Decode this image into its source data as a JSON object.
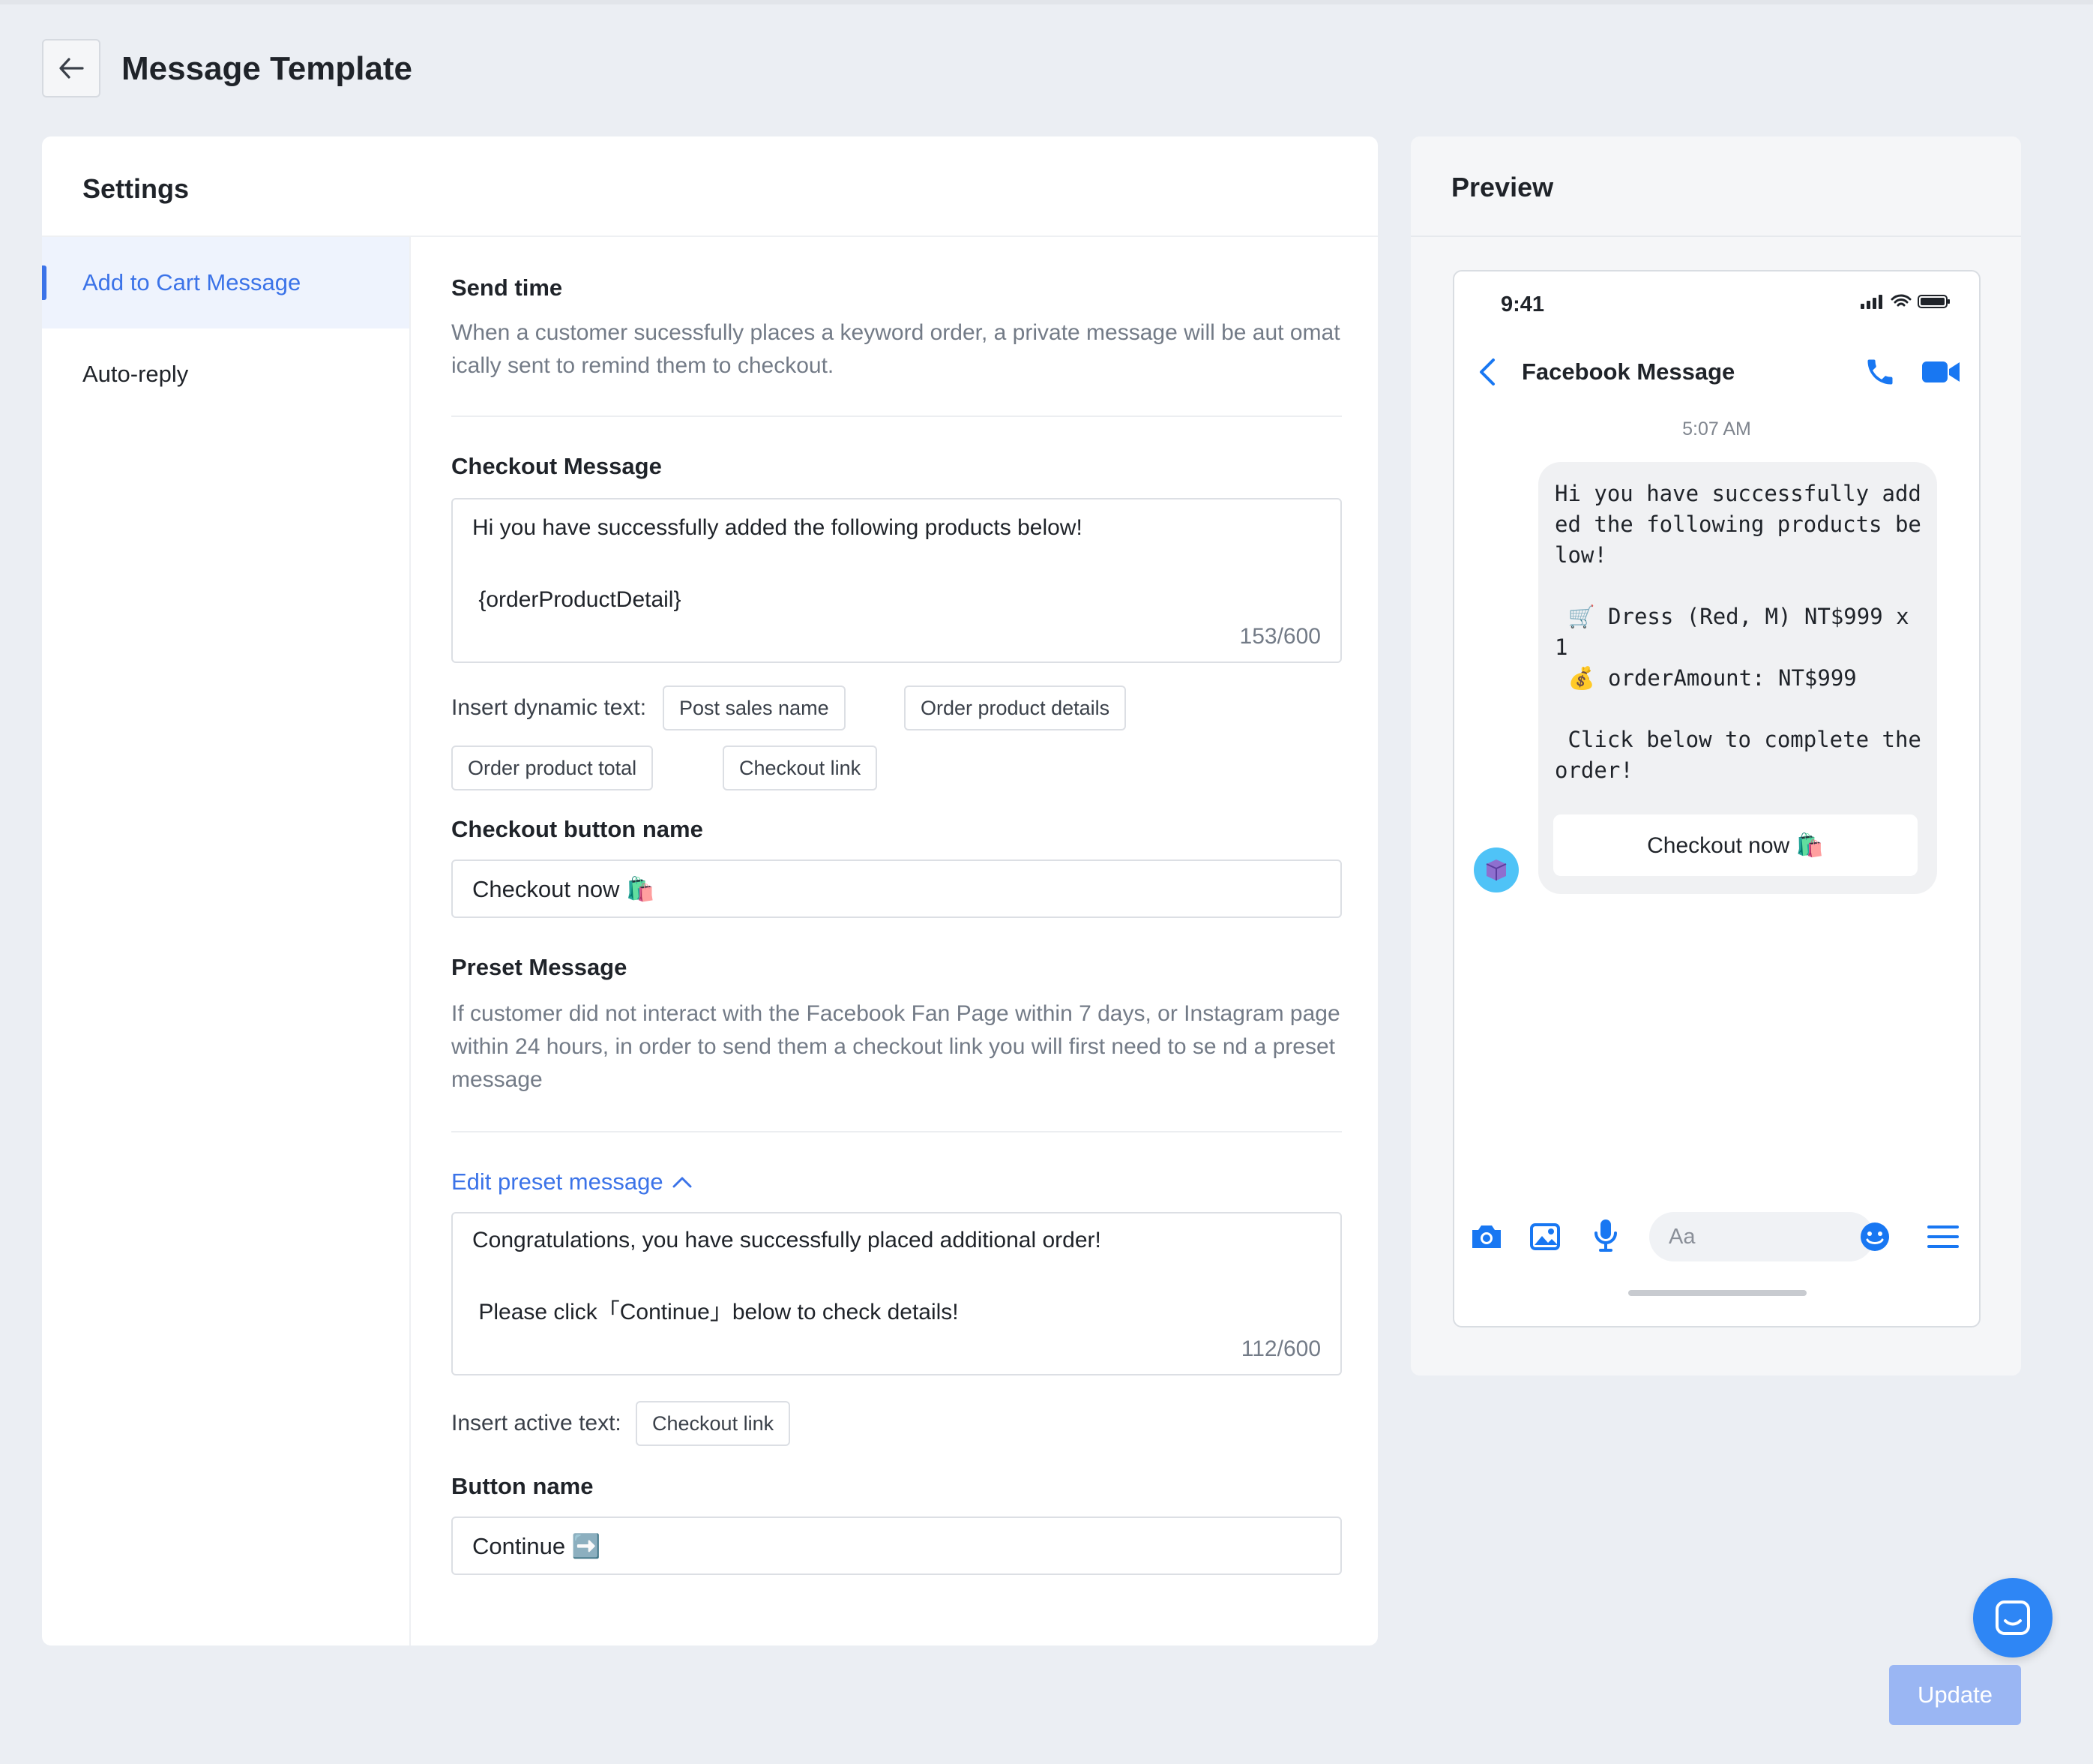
{
  "page": {
    "title": "Message Template"
  },
  "settings": {
    "title": "Settings",
    "nav": [
      {
        "label": "Add to Cart Message",
        "active": true
      },
      {
        "label": "Auto-reply",
        "active": false
      }
    ],
    "send_time": {
      "label": "Send time",
      "help": "When a customer sucessfully places a keyword order, a private message will be aut omatically sent to remind them to checkout."
    },
    "checkout_message": {
      "label": "Checkout Message",
      "line1": "Hi you have successfully added the following products below!",
      "line2": " {orderProductDetail}",
      "counter": "153/600"
    },
    "dynamic": {
      "label": "Insert dynamic text:",
      "chips": [
        "Post sales name",
        "Order product details",
        "Order product total",
        "Checkout link"
      ]
    },
    "checkout_button": {
      "label": "Checkout button name",
      "value": "Checkout now 🛍️"
    },
    "preset": {
      "label": "Preset Message",
      "help": "If customer did not interact with the Facebook Fan Page within 7 days, or Instagram page within 24 hours, in order to send them a checkout link you will first need to se nd a preset message",
      "edit_link": "Edit preset message",
      "line1": "Congratulations, you have successfully placed additional order!",
      "line2": " Please click「Continue」below to check details!",
      "counter": "112/600"
    },
    "active": {
      "label": "Insert active text:",
      "chip": "Checkout link"
    },
    "button_name": {
      "label": "Button name",
      "value": "Continue ➡️"
    }
  },
  "preview": {
    "title": "Preview",
    "status_time": "9:41",
    "app_title": "Facebook Message",
    "chat_time": "5:07 AM",
    "message": "Hi you have successfully added the following products below!\n\n 🛒 Dress (Red, M) NT$999 x 1\n 💰 orderAmount: NT$999\n\n Click below to complete the order!",
    "button": "Checkout now 🛍️",
    "input_placeholder": "Aa"
  },
  "actions": {
    "update": "Update"
  },
  "colors": {
    "accent": "#3B73E8",
    "facebook": "#1877F2",
    "update_disabled": "#9AB6F3"
  },
  "icons": [
    "back-arrow-icon",
    "chevron-up-icon",
    "signal-icon",
    "wifi-icon",
    "battery-icon",
    "fb-back-icon",
    "phone-icon",
    "video-icon",
    "camera-icon",
    "image-icon",
    "mic-icon",
    "emoji-icon",
    "menu-icon",
    "chat-help-icon"
  ]
}
